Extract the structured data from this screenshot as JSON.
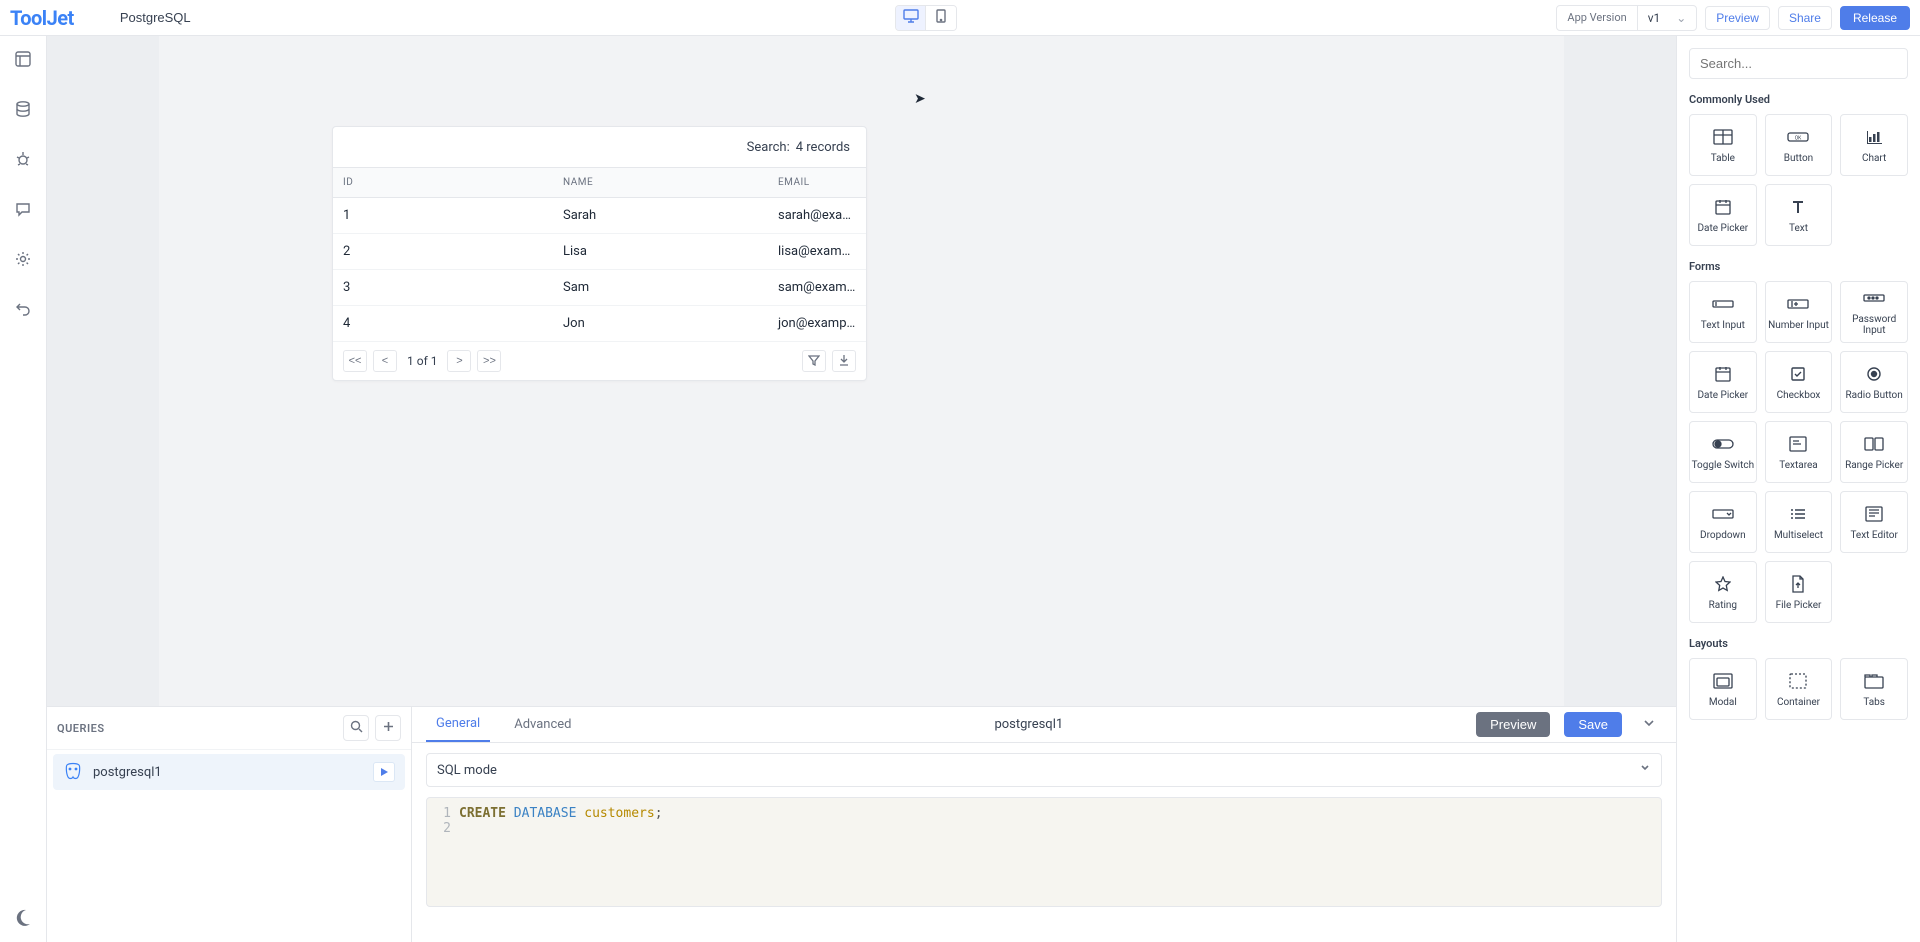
{
  "header": {
    "logo": "ToolJet",
    "app_name": "PostgreSQL",
    "version_label": "App Version",
    "version_value": "v1",
    "preview": "Preview",
    "share": "Share",
    "release": "Release"
  },
  "canvas": {
    "search_label": "Search:",
    "records_text": "4 records",
    "columns": {
      "id": "ID",
      "name": "NAME",
      "email": "EMAIL"
    },
    "rows": [
      {
        "id": "1",
        "name": "Sarah",
        "email": "sarah@example.c"
      },
      {
        "id": "2",
        "name": "Lisa",
        "email": "lisa@example.cor"
      },
      {
        "id": "3",
        "name": "Sam",
        "email": "sam@example.co"
      },
      {
        "id": "4",
        "name": "Jon",
        "email": "jon@example.con"
      }
    ],
    "page_first": "<<",
    "page_prev": "<",
    "page_info": "1 of 1",
    "page_next": ">",
    "page_last": ">>"
  },
  "queries": {
    "title": "QUERIES",
    "item_name": "postgresql1",
    "tab_general": "General",
    "tab_advanced": "Advanced",
    "editor_name": "postgresql1",
    "preview": "Preview",
    "save": "Save",
    "mode_label": "SQL mode",
    "sql_line1_kw": "CREATE",
    "sql_line1_kw2": "DATABASE",
    "sql_line1_ident": "customers",
    "sql_line_nums": {
      "l1": "1",
      "l2": "2"
    }
  },
  "rightbar": {
    "search_placeholder": "Search...",
    "group_common": "Commonly Used",
    "common": {
      "table": "Table",
      "button": "Button",
      "chart": "Chart",
      "date_picker": "Date Picker",
      "text": "Text"
    },
    "group_forms": "Forms",
    "forms": {
      "text_input": "Text Input",
      "number_input": "Number Input",
      "password_input": "Password Input",
      "date_picker": "Date Picker",
      "checkbox": "Checkbox",
      "radio": "Radio Button",
      "toggle": "Toggle Switch",
      "textarea": "Textarea",
      "range": "Range Picker",
      "dropdown": "Dropdown",
      "multiselect": "Multiselect",
      "text_editor": "Text Editor",
      "rating": "Rating",
      "file_picker": "File Picker"
    },
    "group_layouts": "Layouts",
    "layouts": {
      "modal": "Modal",
      "container": "Container",
      "tabs": "Tabs"
    }
  }
}
